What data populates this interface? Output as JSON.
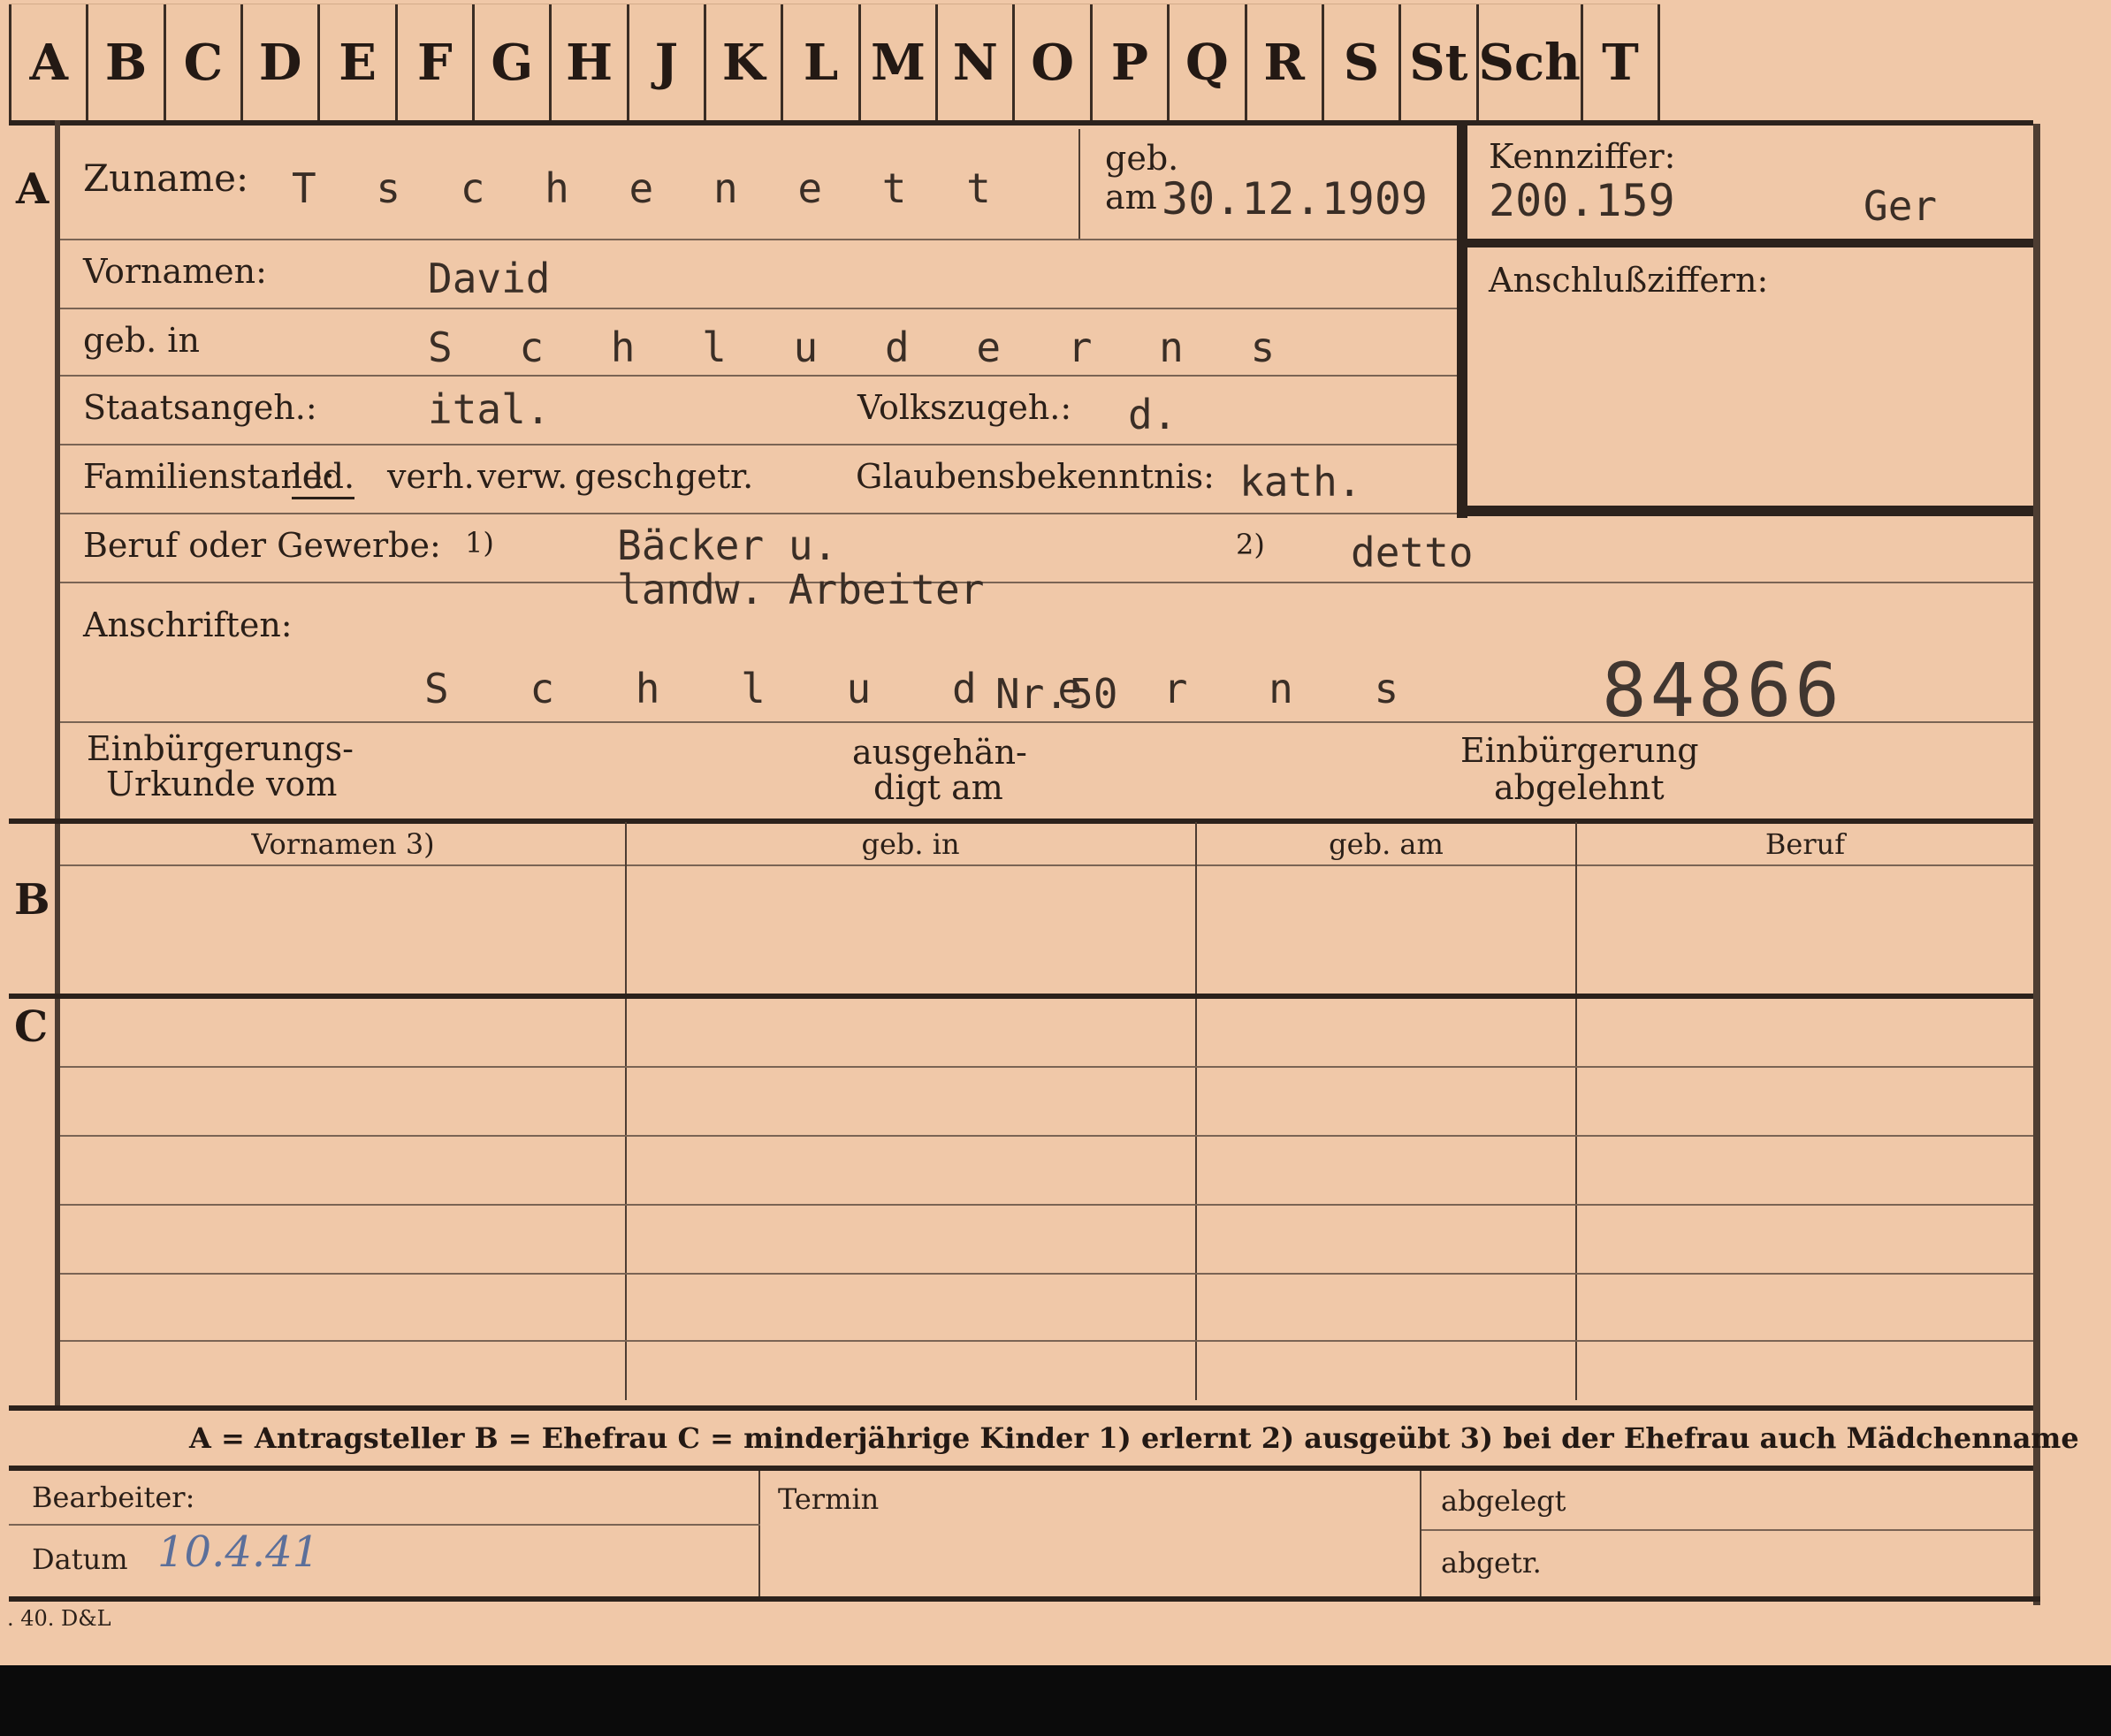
{
  "alphabet_tabs": [
    "A",
    "B",
    "C",
    "D",
    "E",
    "F",
    "G",
    "H",
    "J",
    "K",
    "L",
    "M",
    "N",
    "O",
    "P",
    "Q",
    "R",
    "S",
    "St",
    "Sch",
    "T"
  ],
  "section_a": {
    "marker": "A",
    "surname_label": "Zuname:",
    "surname": "T s c h e n e t t",
    "birth_label_1": "geb.",
    "birth_label_2": "am",
    "birth_date": "30.12.1909",
    "id_label": "Kennziffer:",
    "id_value": "200.159",
    "id_code": "Ger",
    "connection_label": "Anschlußziffern:",
    "first_names_label": "Vornamen:",
    "first_names": "David",
    "birthplace_label": "geb. in",
    "birthplace": "S c h l u d e r n s",
    "citizenship_label": "Staatsangeh.:",
    "citizenship": "ital.",
    "ethnicity_label": "Volkszugeh.:",
    "ethnicity": "d.",
    "marital_label": "Familienstand:",
    "marital_options": [
      "led.",
      "verh.",
      "verw.",
      "gesch.",
      "getr."
    ],
    "religion_label": "Glaubensbekenntnis:",
    "religion": "kath.",
    "occupation_label": "Beruf oder Gewerbe:",
    "note1": "1)",
    "occupation_learned_1": "Bäcker u.",
    "occupation_learned_2": "landw. Arbeiter",
    "note2": "2)",
    "occupation_practiced": "detto",
    "addresses_label": "Anschriften:",
    "address": "S c h l u d e r n s",
    "address_number": "Nr.50",
    "stamp_number": "84866",
    "naturalization_doc_label_1": "Einbürgerungs-",
    "naturalization_doc_label_2": "Urkunde vom",
    "handed_label_1": "ausgehän-",
    "handed_label_2": "digt am",
    "rejected_label_1": "Einbürgerung",
    "rejected_label_2": "abgelehnt"
  },
  "section_b": {
    "marker": "B",
    "columns": [
      "Vornamen 3)",
      "geb. in",
      "geb. am",
      "Beruf"
    ]
  },
  "section_c": {
    "marker": "C"
  },
  "legend": "A = Antragsteller   B = Ehefrau   C = minderjährige Kinder   1) erlernt   2) ausgeübt   3) bei der Ehefrau auch Mädchenname",
  "footer": {
    "processor_label": "Bearbeiter:",
    "date_label": "Datum",
    "date_value": "10.4.41",
    "deadline_label": "Termin",
    "filed_label": "abgelegt",
    "signed_label": "abgetr.",
    "print_code": ". 40. D&L"
  }
}
